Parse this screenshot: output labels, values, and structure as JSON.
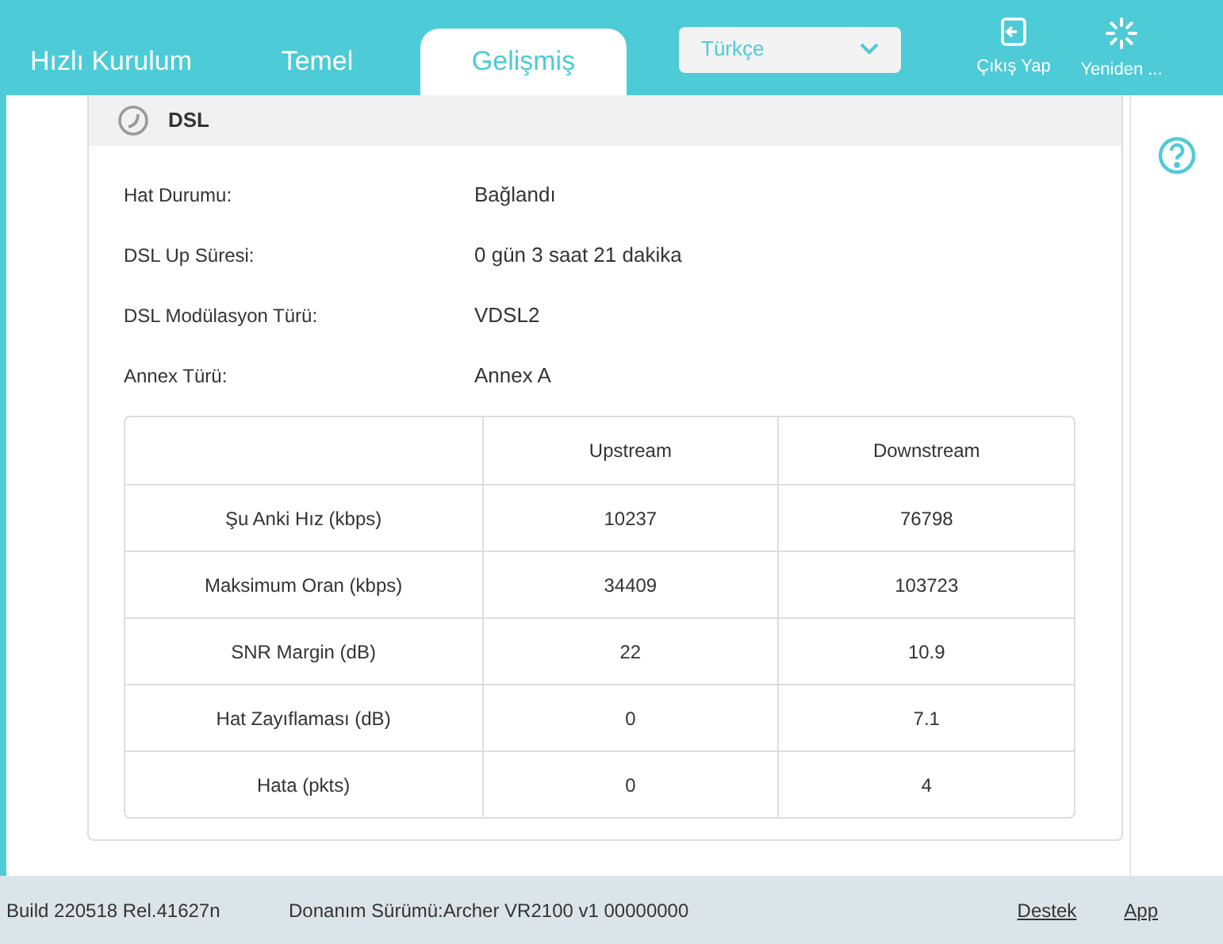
{
  "nav_tabs": [
    {
      "label": "Hızlı Kurulum",
      "selected": false
    },
    {
      "label": "Temel",
      "selected": false
    },
    {
      "label": "Gelişmiş",
      "selected": true
    }
  ],
  "language_select": {
    "value": "Türkçe"
  },
  "header_actions": [
    {
      "kind": "logout",
      "label": "Çıkış Yap"
    },
    {
      "kind": "reboot",
      "label": "Yeniden ..."
    }
  ],
  "section": {
    "title": "DSL",
    "fields": [
      {
        "label": "Hat Durumu:",
        "value": "Bağlandı"
      },
      {
        "label": "DSL Up Süresi:",
        "value": "0 gün 3 saat 21 dakika"
      },
      {
        "label": "DSL Modülasyon Türü:",
        "value": "VDSL2"
      },
      {
        "label": "Annex Türü:",
        "value": "Annex A"
      }
    ],
    "table": {
      "columns": [
        "Upstream",
        "Downstream"
      ],
      "rows": [
        {
          "label": "Şu Anki Hız (kbps)",
          "cells": [
            "10237",
            "76798"
          ]
        },
        {
          "label": "Maksimum Oran (kbps)",
          "cells": [
            "34409",
            "103723"
          ]
        },
        {
          "label": "SNR Margin (dB)",
          "cells": [
            "22",
            "10.9"
          ]
        },
        {
          "label": "Hat Zayıflaması (dB)",
          "cells": [
            "0",
            "7.1"
          ]
        },
        {
          "label": "Hata (pkts)",
          "cells": [
            "0",
            "4"
          ]
        }
      ]
    }
  },
  "status_bar": {
    "build": "Build 220518 Rel.41627n",
    "hardware": "Donanım Sürümü:Archer VR2100 v1 00000000",
    "links": [
      "Destek",
      "App"
    ]
  }
}
